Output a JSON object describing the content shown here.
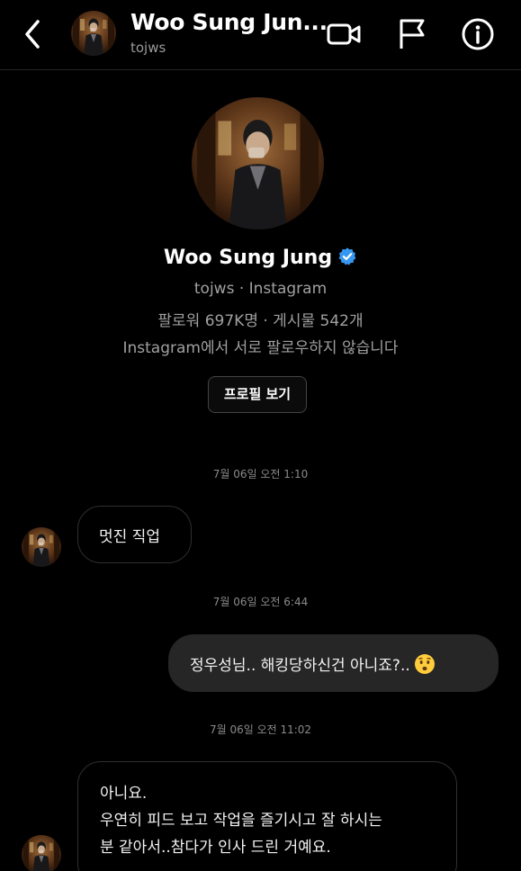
{
  "header": {
    "name": "Woo Sung Jun...",
    "username": "tojws",
    "icons": [
      "back-chevron-icon",
      "video-call-icon",
      "flag-icon",
      "info-icon"
    ]
  },
  "profile": {
    "name": "Woo Sung Jung",
    "subtitle": "tojws · Instagram",
    "stats": "팔로워 697K명 · 게시물 542개",
    "relation": "Instagram에서 서로 팔로우하지 않습니다",
    "view_profile_label": "프로필 보기"
  },
  "messages": {
    "ts1": "7월 06일 오전 1:10",
    "msg1": "멋진 직업",
    "ts2": "7월 06일 오전 6:44",
    "msg2": "정우성님.. 해킹당하신건 아니죠?..",
    "ts3": "7월 06일 오전 11:02",
    "msg3_lines": [
      "아니요.",
      "우연히 피드 보고 작업을 즐기시고 잘 하시는",
      "분 같아서..참다가 인사 드린 거예요."
    ]
  },
  "colors": {
    "background": "#000000",
    "verified": "#3797f0",
    "outgoing_bubble": "#262626"
  }
}
